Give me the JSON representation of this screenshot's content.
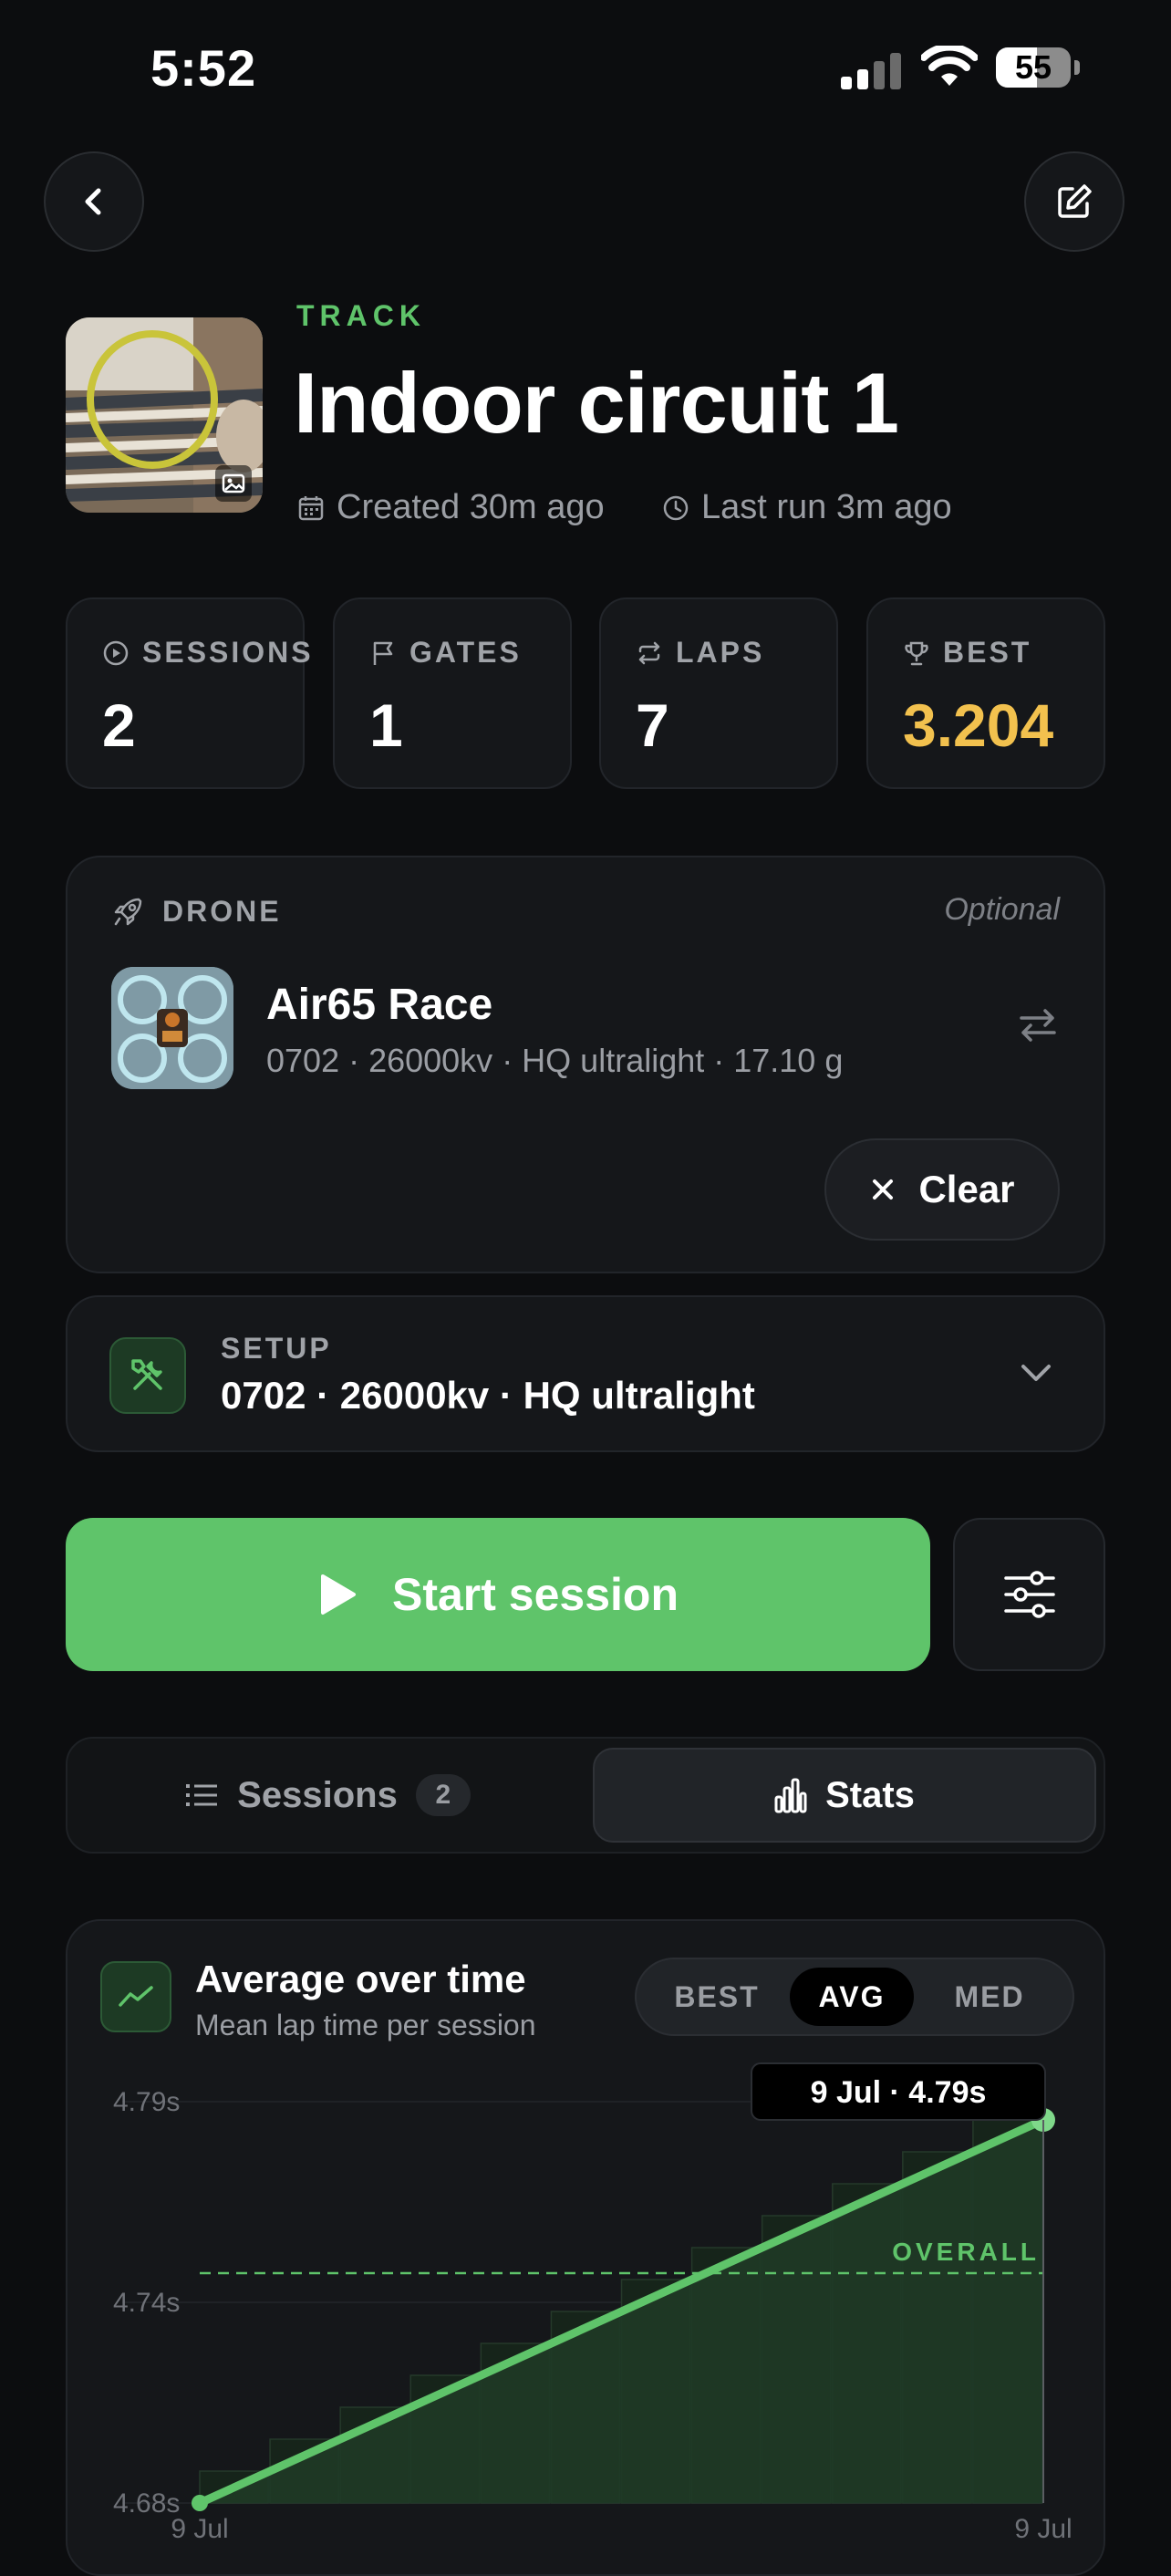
{
  "status_bar": {
    "time": "5:52",
    "battery": "55"
  },
  "nav": {
    "back_icon": "chevron-left-icon",
    "edit_icon": "edit-icon"
  },
  "track": {
    "label": "TRACK",
    "title": "Indoor circuit 1",
    "created": "Created 30m ago",
    "last_run": "Last run 3m ago"
  },
  "stats": [
    {
      "label": "SESSIONS",
      "value": "2",
      "icon": "play-circle-icon"
    },
    {
      "label": "GATES",
      "value": "1",
      "icon": "flag-icon"
    },
    {
      "label": "LAPS",
      "value": "7",
      "icon": "repeat-icon"
    },
    {
      "label": "BEST",
      "value": "3.204",
      "icon": "trophy-icon",
      "color": "#f2c14e"
    }
  ],
  "drone": {
    "section_label": "DRONE",
    "optional": "Optional",
    "name": "Air65 Race",
    "specs": "0702 · 26000kv · HQ ultralight · 17.10 g",
    "clear_label": "Clear"
  },
  "setup": {
    "label": "SETUP",
    "value": "0702 · 26000kv · HQ ultralight"
  },
  "actions": {
    "start_label": "Start session"
  },
  "tabs": [
    {
      "label": "Sessions",
      "count": "2",
      "active": false
    },
    {
      "label": "Stats",
      "active": true
    }
  ],
  "chart_card": {
    "title": "Average over time",
    "subtitle": "Mean lap time per session",
    "modes": [
      "BEST",
      "AVG",
      "MED"
    ],
    "active_mode": "AVG",
    "tooltip": "9 Jul · 4.79s",
    "overall_label": "OVERALL"
  },
  "chart_data": {
    "type": "line",
    "x": [
      "9 Jul",
      "9 Jul"
    ],
    "series": [
      {
        "values": [
          4.68,
          4.785
        ]
      }
    ],
    "y_ticks": [
      "4.79s",
      "4.74s",
      "4.68s"
    ],
    "x_tick_labels": [
      "9 Jul",
      "9 Jul"
    ],
    "ylim": [
      4.68,
      4.79
    ],
    "overall": 4.743,
    "accent": "#5fc46a"
  },
  "colors": {
    "accent": "#5fc46a",
    "gold": "#f2c14e",
    "background": "#0c0d0f"
  }
}
